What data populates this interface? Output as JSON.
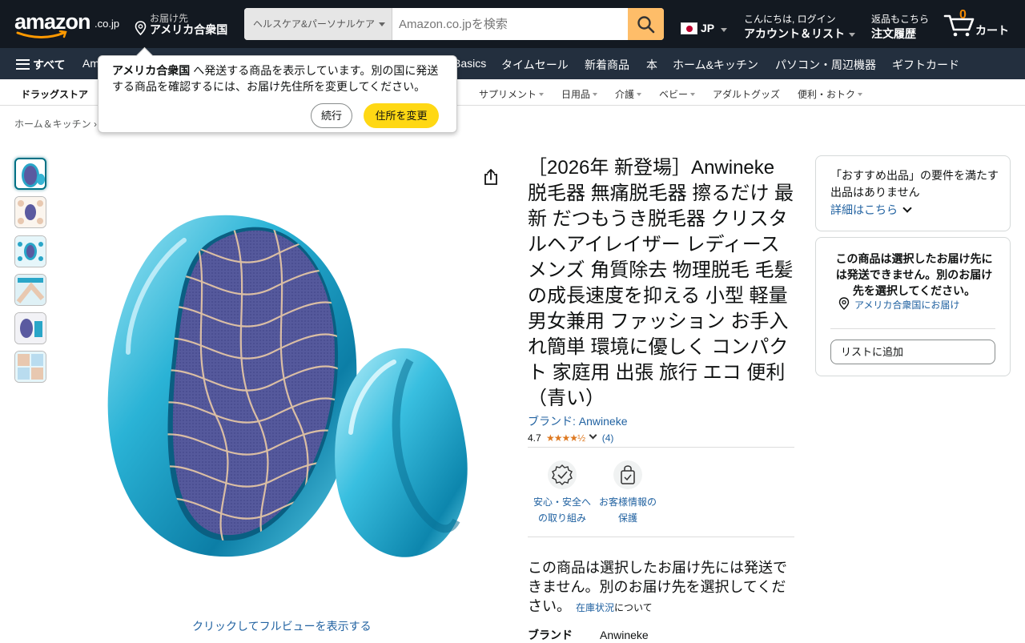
{
  "header": {
    "logo_text": "amazon",
    "logo_tld": ".co.jp",
    "deliver_to_label": "お届け先",
    "deliver_to_location": "アメリカ合衆国",
    "search_category": "ヘルスケア&パーソナルケア",
    "search_placeholder": "Amazon.co.jpを検索",
    "language": "JP",
    "account_greeting": "こんにちは, ログイン",
    "account_label": "アカウント＆リスト",
    "returns_label": "返品もこちら",
    "orders_label": "注文履歴",
    "cart_count": "0",
    "cart_label": "カート"
  },
  "navbar": {
    "all_label": "すべて",
    "items": [
      "Am",
      "Basics",
      "タイムセール",
      "新着商品",
      "本",
      "ホーム&キッチン",
      "パソコン・周辺機器",
      "ギフトカード"
    ]
  },
  "subnav": {
    "items": [
      "ドラッグストア",
      "サプリメント",
      "日用品",
      "介護",
      "ベビー",
      "アダルトグッズ",
      "便利・おトク"
    ]
  },
  "breadcrumb": "ホーム＆キッチン ›",
  "popover": {
    "location_bold": "アメリカ合衆国",
    "message": " へ発送する商品を表示しています。別の国に発送する商品を確認するには、お届け先住所を変更してください。",
    "continue_label": "続行",
    "change_label": "住所を変更"
  },
  "gallery": {
    "full_view_link": "クリックしてフルビューを表示する"
  },
  "product": {
    "title": "［2026年 新登場］Anwineke 脱毛器 無痛脱毛器 擦るだけ 最新 だつもうき脱毛器 クリスタルヘアイレイザー レディース メンズ 角質除去 物理脱毛 毛髪の成長速度を抑える 小型 軽量 男女兼用 ファッション お手入れ簡単 環境に優しく コンパクト 家庭用 出張 旅行 エコ 便利（青い）",
    "brand_link": "ブランド: Anwineke",
    "rating": "4.7",
    "stars": "★★★★½",
    "rating_count": "(4)",
    "badges": [
      {
        "label": "安心・安全への取り組み"
      },
      {
        "label": "お客様情報の保護"
      }
    ],
    "unavailable_msg": "この商品は選択したお届け先には発送できません。別のお届け先を選択してください。",
    "stock_link": "在庫状況",
    "stock_suffix": "について",
    "spec_key": "ブランド",
    "spec_value": "Anwineke"
  },
  "buybox": {
    "featured_msg": "「おすすめ出品」の要件を満たす出品はありません",
    "details_link": "詳細はこちら",
    "ship_msg": "この商品は選択したお届け先には発送できません。別のお届け先を選択してください。",
    "deliver_link": "アメリカ合衆国にお届け",
    "add_list_label": "リストに追加"
  }
}
